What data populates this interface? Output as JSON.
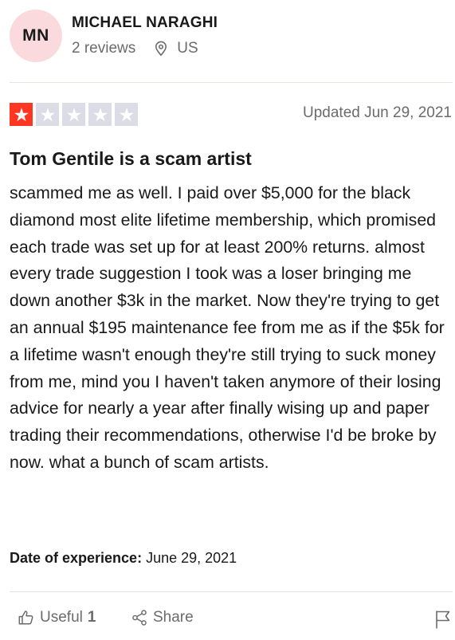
{
  "reviewer": {
    "initials": "MN",
    "name": "MICHAEL NARAGHI",
    "reviews": "2 reviews",
    "country": "US"
  },
  "review": {
    "rating": 1,
    "rating_max": 5,
    "updated": "Updated Jun 29, 2021",
    "title": "Tom Gentile is a scam artist",
    "body": "scammed me as well. I paid over $5,000 for the black diamond most elite lifetime membership, which promised each trade was set up for at least 200% returns. almost every trade suggestion I took was a loser bringing me down another $3k in the market. Now they're trying to get an annual $195 maintenance fee from me as if the $5k for a lifetime wasn't enough they're still trying to suck money from me, mind you I haven't taken anymore of their losing advice for nearly a year after finally wising up and paper trading their recommendations, otherwise I'd be broke by now. what a bunch of scam artists.",
    "experience_label": "Date of experience:",
    "experience_date": "June 29, 2021"
  },
  "actions": {
    "useful_label": "Useful",
    "useful_count": "1",
    "share_label": "Share"
  },
  "colors": {
    "star_filled": "#ff3722",
    "star_empty": "#dcdce6",
    "avatar_bg": "#fadadd"
  },
  "icons": {
    "location": "location-pin-icon",
    "useful": "thumbs-up-icon",
    "share": "share-icon",
    "flag": "flag-icon"
  }
}
